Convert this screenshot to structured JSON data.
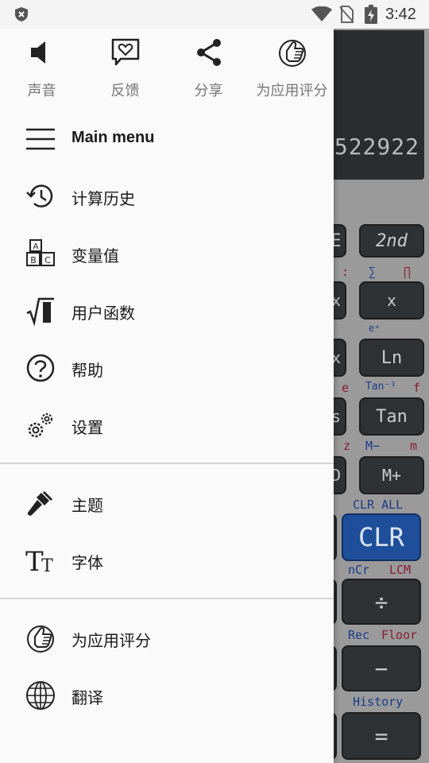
{
  "status_bar": {
    "time": "3:42"
  },
  "quick_actions": [
    {
      "icon": "speaker-icon",
      "label": "声音"
    },
    {
      "icon": "feedback-heart-icon",
      "label": "反馈"
    },
    {
      "icon": "share-icon",
      "label": "分享"
    },
    {
      "icon": "thumbs-up-icon",
      "label": "为应用评分"
    }
  ],
  "menu": {
    "main_menu": "Main menu",
    "history": "计算历史",
    "variables": "变量值",
    "user_functions": "用户函数",
    "help": "帮助",
    "settings": "设置",
    "theme": "主题",
    "font": "字体",
    "rate": "为应用评分",
    "translate": "翻译"
  },
  "calculator": {
    "display_value": "522922",
    "keys": {
      "second": "2nd",
      "x": "x",
      "ln": "Ln",
      "tan": "Tan",
      "m_plus": "M+",
      "clr": "CLR",
      "divide": "÷",
      "minus": "−",
      "equals": "="
    },
    "labels": {
      "colon": ":",
      "sum": "∑",
      "prod": "∏",
      "ex": "eˣ",
      "e": "e",
      "tan_inv": "Tan⁻¹",
      "f": "f",
      "z": "z",
      "m_minus": "M−",
      "m": "m",
      "clr_all": "CLR ALL",
      "ncr": "nCr",
      "lcm": "LCM",
      "rec": "Rec",
      "floor": "Floor",
      "history": "History"
    }
  }
}
